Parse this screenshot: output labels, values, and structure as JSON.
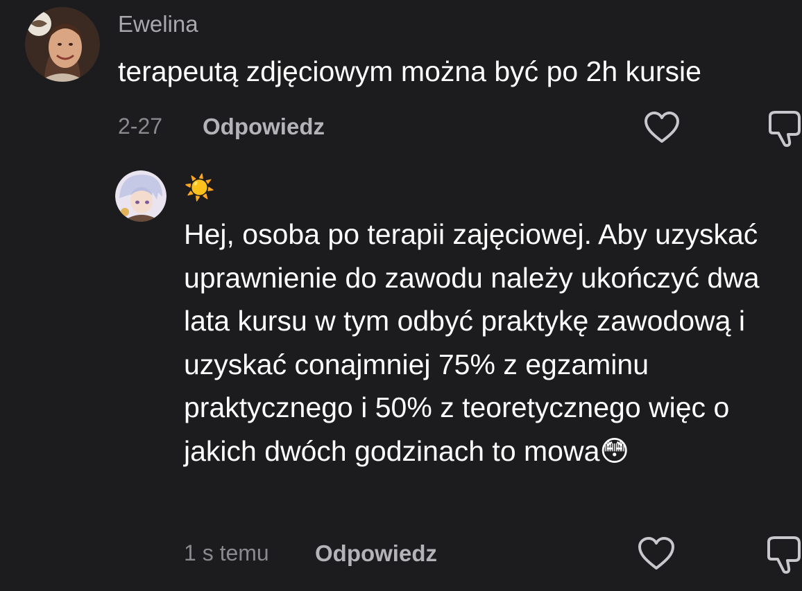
{
  "comments": [
    {
      "username": "Ewelina",
      "text": "terapeutą zdjęciowym można być po 2h kursie",
      "timestamp": "2-27",
      "reply_label": "Odpowiedz",
      "avatar_icon": "user-avatar-photo",
      "like_icon": "heart-outline-icon",
      "dislike_icon": "thumbs-down-outline-icon"
    },
    {
      "username": "☀️",
      "text": "Hej, osoba po terapii zajęciowej. Aby uzyskać uprawnienie do zawodu należy ukończyć dwa lata kursu w tym odbyć praktykę zawodową i uzyskać conajmniej 75% z egzaminu praktycznego i 50% z teoretycznego więc o jakich dwóch godzinach to mowa😳",
      "timestamp": "1 s temu",
      "reply_label": "Odpowiedz",
      "avatar_icon": "anime-avatar",
      "like_icon": "heart-outline-icon",
      "dislike_icon": "thumbs-down-outline-icon"
    }
  ],
  "colors": {
    "background": "#1c1c1e",
    "username": "#a9a9ad",
    "text": "#ffffff",
    "meta": "#8a8a8e",
    "reply": "#b4b4b8",
    "icon": "#c7c7cc"
  }
}
